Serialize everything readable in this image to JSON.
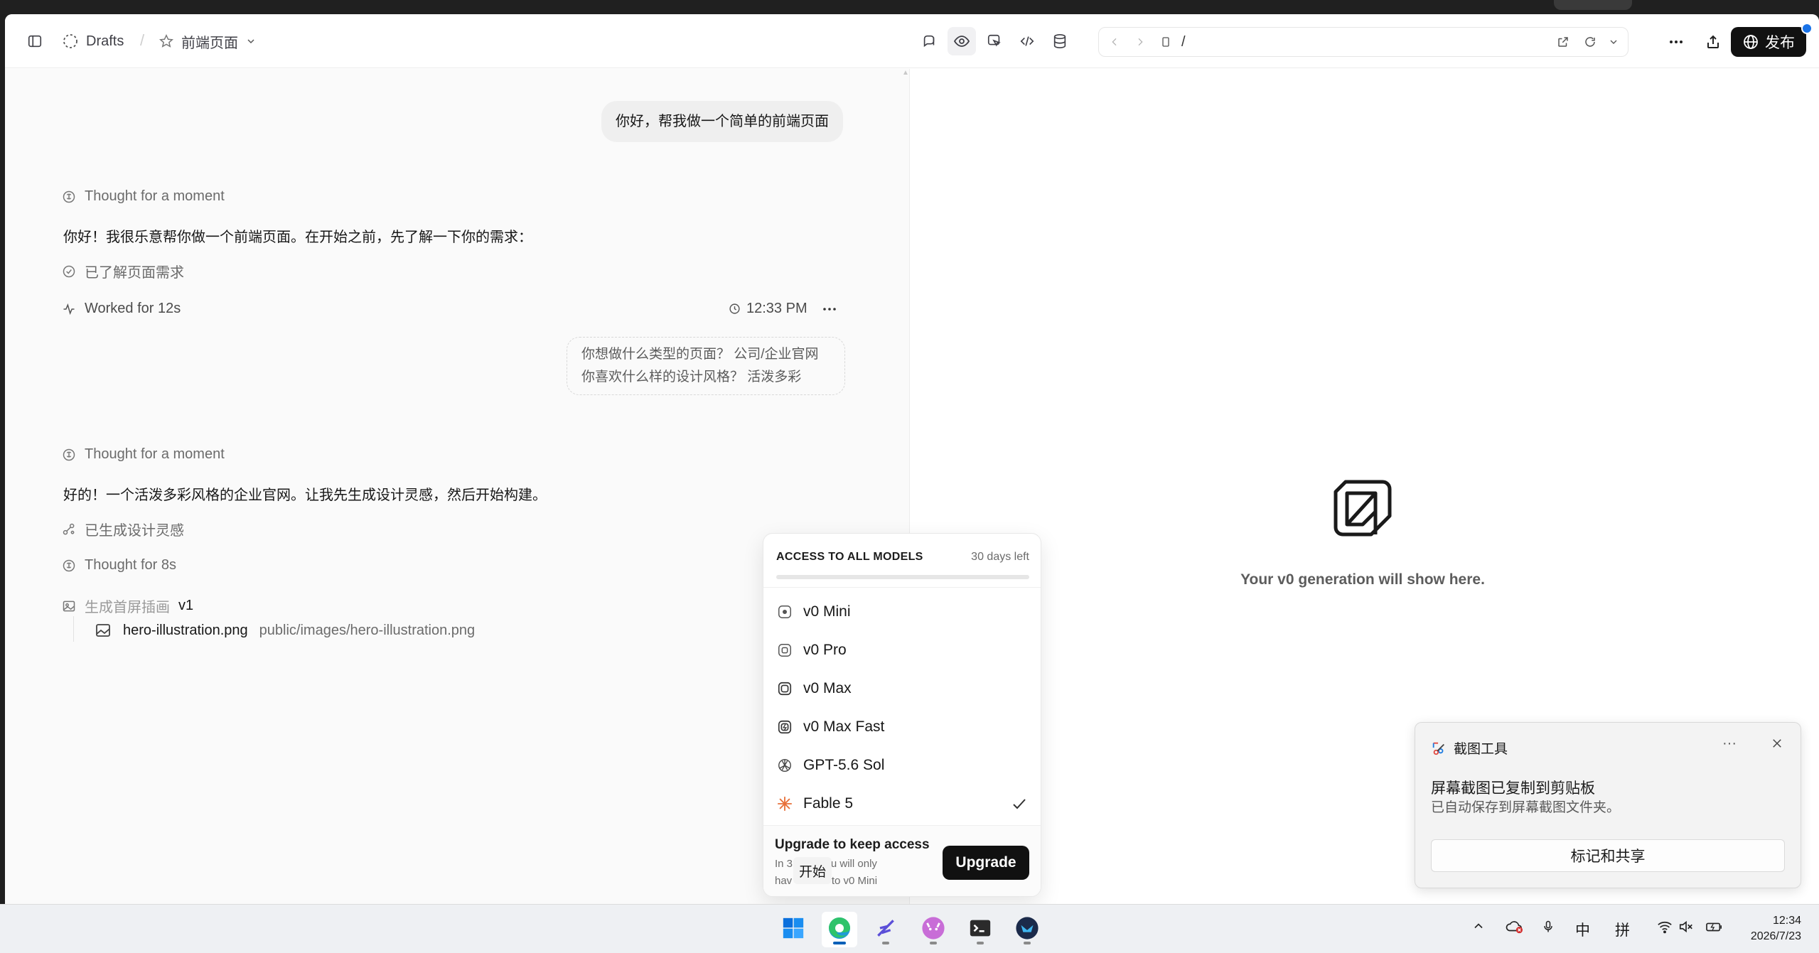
{
  "header": {
    "drafts_label": "Drafts",
    "project_label": "前端页面",
    "url_path": "/",
    "publish_label": "发布"
  },
  "chat": {
    "user_message_1": "你好，帮我做一个简单的前端页面",
    "thought_1": "Thought for a moment",
    "assistant_message_1": "你好！我很乐意帮你做一个前端页面。在开始之前，先了解一下你的需求：",
    "step_understood": "已了解页面需求",
    "worked_label": "Worked for 12s",
    "timestamp": "12:33 PM",
    "answer_line_1": "你想做什么类型的页面？ 公司/企业官网",
    "answer_line_2": "你喜欢什么样的设计风格？ 活泼多彩",
    "thought_2": "Thought for a moment",
    "assistant_message_2": "好的！一个活泼多彩风格的企业官网。让我先生成设计灵感，然后开始构建。",
    "step_inspiration": "已生成设计灵感",
    "thought_3": "Thought for 8s",
    "step_generating": "生成首屏插画",
    "step_version": "v1",
    "file_name": "hero-illustration.png",
    "file_path": "public/images/hero-illustration.png"
  },
  "model_menu": {
    "access_title": "ACCESS TO ALL MODELS",
    "days_left": "30 days left",
    "access_progress": 0.0,
    "models": [
      {
        "label": "v0 Mini",
        "icon": "v0-mini-icon",
        "selected": false
      },
      {
        "label": "v0 Pro",
        "icon": "v0-pro-icon",
        "selected": false
      },
      {
        "label": "v0 Max",
        "icon": "v0-max-icon",
        "selected": false
      },
      {
        "label": "v0 Max Fast",
        "icon": "v0-max-fast-icon",
        "selected": false
      },
      {
        "label": "GPT-5.6 Sol",
        "icon": "openai-icon",
        "selected": false
      },
      {
        "label": "Fable 5",
        "icon": "fable-starburst-icon",
        "selected": true
      }
    ],
    "upgrade_title": "Upgrade to keep access",
    "upgrade_desc_line_1": "In 3",
    "upgrade_desc_line_1b": "you will only",
    "upgrade_desc_line_2": "hav",
    "upgrade_desc_line_2b": "s to v0 Mini",
    "upgrade_button": "Upgrade",
    "tooltip_start": "开始"
  },
  "preview": {
    "empty_text": "Your v0 generation will show here."
  },
  "snip_notification": {
    "app_name": "截图工具",
    "title": "屏幕截图已复制到剪贴板",
    "body": "已自动保存到屏幕截图文件夹。",
    "action_button": "标记和共享"
  },
  "taskbar": {
    "ime_lang": "中",
    "ime_mode": "拼",
    "time": "12:34",
    "date": "2026/7/23"
  },
  "colors": {
    "accent_dark": "#111111",
    "chat_bg": "#fafafa",
    "fable_orange": "#e8703a",
    "windows_blue": "#005fb8"
  }
}
